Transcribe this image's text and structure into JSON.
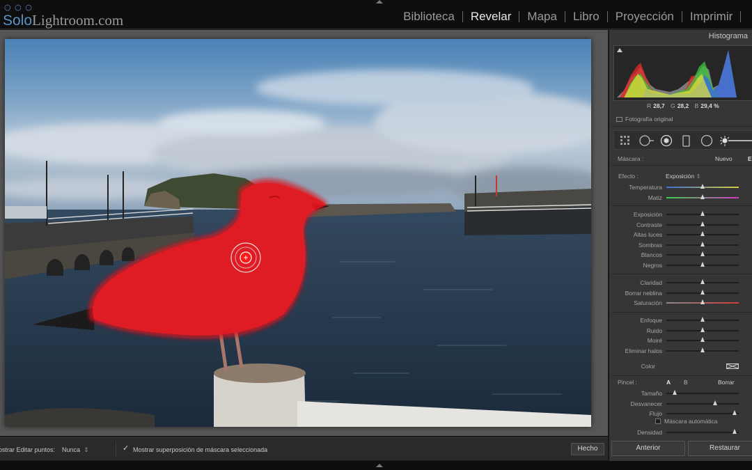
{
  "header": {
    "logo_solo": "Solo",
    "logo_rest": "Lightroom.com",
    "modules": [
      {
        "label": "Biblioteca",
        "active": false
      },
      {
        "label": "Revelar",
        "active": true
      },
      {
        "label": "Mapa",
        "active": false
      },
      {
        "label": "Libro",
        "active": false
      },
      {
        "label": "Proyección",
        "active": false
      },
      {
        "label": "Imprimir",
        "active": false
      }
    ]
  },
  "toolbar": {
    "edit_points_label": "ostrar Editar puntos:",
    "edit_points_value": "Nunca",
    "overlay_checked": true,
    "overlay_label": "Mostrar superposición de máscara seleccionada",
    "done_label": "Hecho"
  },
  "histogram": {
    "title": "Histograma",
    "r_label": "R",
    "r_value": "28,7",
    "g_label": "G",
    "g_value": "28,2",
    "b_label": "B",
    "b_value": "29,4 %",
    "original_label": "Fotografía original"
  },
  "mask": {
    "label": "Máscara :",
    "new_label": "Nuevo",
    "edit_label": "E"
  },
  "effect": {
    "label": "Efecto :",
    "value": "Exposición",
    "sliders_group1": [
      {
        "name": "Temperatura",
        "pos": 0.5,
        "track": "temp"
      },
      {
        "name": "Matiz",
        "pos": 0.5,
        "track": "tint"
      }
    ],
    "sliders_group2": [
      {
        "name": "Exposición",
        "pos": 0.5
      },
      {
        "name": "Contraste",
        "pos": 0.5
      },
      {
        "name": "Altas luces",
        "pos": 0.5
      },
      {
        "name": "Sombras",
        "pos": 0.5
      },
      {
        "name": "Blancos",
        "pos": 0.5
      },
      {
        "name": "Negros",
        "pos": 0.5
      }
    ],
    "sliders_group3": [
      {
        "name": "Claridad",
        "pos": 0.5
      },
      {
        "name": "Borrar neblina",
        "pos": 0.5
      },
      {
        "name": "Saturación",
        "pos": 0.5,
        "track": "sat"
      }
    ],
    "sliders_group4": [
      {
        "name": "Enfoque",
        "pos": 0.5
      },
      {
        "name": "Ruido",
        "pos": 0.5
      },
      {
        "name": "Moiré",
        "pos": 0.5
      },
      {
        "name": "Eliminar halos",
        "pos": 0.5
      }
    ],
    "color_label": "Color"
  },
  "brush": {
    "label": "Pincel :",
    "a_label": "A",
    "b_label": "B",
    "erase_label": "Borrar",
    "sliders": [
      {
        "name": "Tamaño",
        "pos": 0.12
      },
      {
        "name": "Desvanecer",
        "pos": 0.68
      },
      {
        "name": "Flujo",
        "pos": 0.95
      }
    ],
    "automask_label": "Máscara automática",
    "density_label": "Densidad",
    "density_pos": 0.95
  },
  "footer": {
    "prev_label": "Anterior",
    "reset_label": "Restaurar"
  },
  "colors": {
    "mask_overlay": "#e0141c",
    "panel_bg": "#363636",
    "photo_sky": "#6d93b8",
    "water": "#24354a"
  }
}
